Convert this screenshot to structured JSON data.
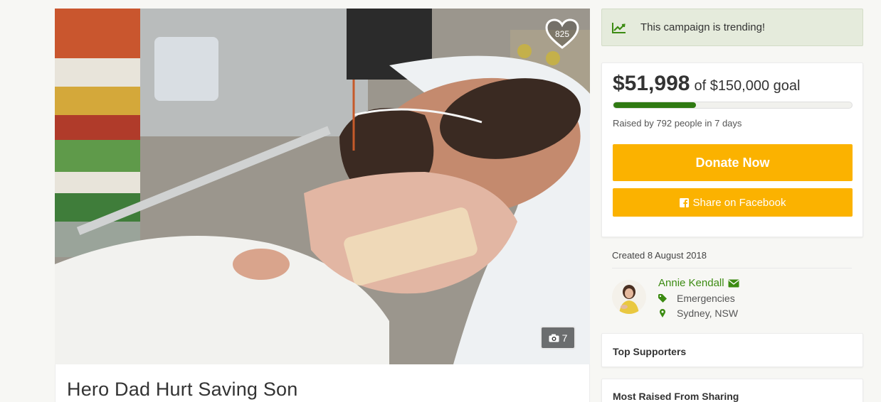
{
  "campaign": {
    "title": "Hero Dad Hurt Saving Son",
    "hearts": "825",
    "photo_count": "7"
  },
  "trending": {
    "text": "This campaign is trending!",
    "icon": "trending-chart-icon"
  },
  "funds": {
    "raised": "$51,998",
    "goal_text": "of $150,000 goal",
    "progress_fraction": 0.347,
    "raised_by": "Raised by 792 people in 7 days",
    "donate_label": "Donate Now",
    "share_label": "Share on Facebook"
  },
  "meta": {
    "created": "Created 8 August 2018",
    "organizer_name": "Annie Kendall",
    "category": "Emergencies",
    "location": "Sydney, NSW"
  },
  "sections": {
    "top_supporters": "Top Supporters",
    "most_raised_sharing": "Most Raised From Sharing"
  },
  "colors": {
    "brand_green": "#3c8b12",
    "progress_green": "#2f7a12",
    "button_yellow": "#fbb200",
    "trend_bg": "#e5ebdc"
  }
}
